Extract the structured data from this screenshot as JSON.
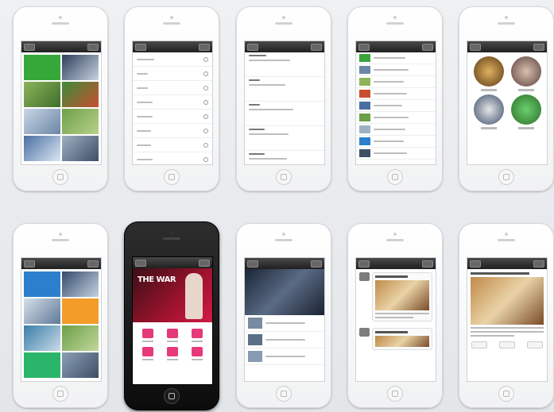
{
  "colors": {
    "navbar": "#2a2a2a",
    "accent_pink": "#e6397a",
    "tile_green": "#3aa53a",
    "tile_blue": "#2b7fcc",
    "tile_orange": "#f39c2a"
  },
  "phones": [
    {
      "id": "phone-1",
      "style": "white",
      "screen": "tile-grid"
    },
    {
      "id": "phone-2",
      "style": "white",
      "screen": "text-list"
    },
    {
      "id": "phone-3",
      "style": "white",
      "screen": "text-list-detail"
    },
    {
      "id": "phone-4",
      "style": "white",
      "screen": "thumb-list"
    },
    {
      "id": "phone-5",
      "style": "white",
      "screen": "circle-grid"
    },
    {
      "id": "phone-6",
      "style": "white",
      "screen": "metro-tiles"
    },
    {
      "id": "phone-7",
      "style": "black",
      "screen": "banner-icons"
    },
    {
      "id": "phone-8",
      "style": "white",
      "screen": "news-feed"
    },
    {
      "id": "phone-9",
      "style": "white",
      "screen": "chat-messages"
    },
    {
      "id": "phone-10",
      "style": "white",
      "screen": "chat-article"
    }
  ],
  "banner_text": "THE WAR"
}
